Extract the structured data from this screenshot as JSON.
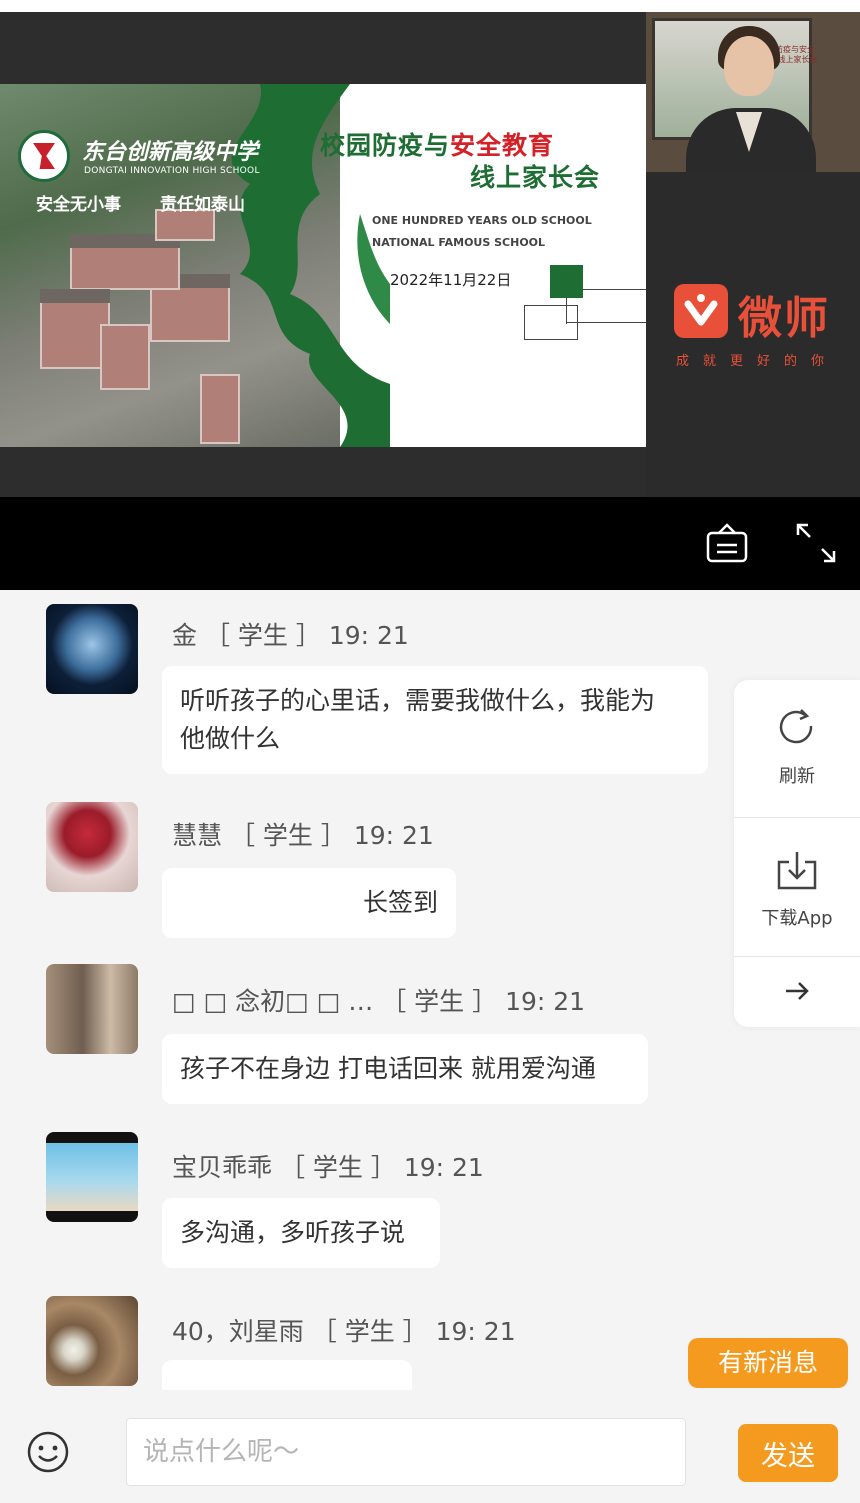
{
  "slide": {
    "school_name": "东台创新高级中学",
    "school_en": "DONGTAI INNOVATION HIGH SCHOOL",
    "slogan_left": "安全无小事",
    "slogan_right": "责任如泰山",
    "title_part1": "校园防疫与",
    "title_part2": "安全教育",
    "title_line2": "线上家长会",
    "en_line1": "ONE HUNDRED YEARS OLD SCHOOL",
    "en_line2": "NATIONAL FAMOUS SCHOOL",
    "date": "2022年11月22日"
  },
  "camera": {
    "screen_text": "校园防疫与安全教育 线上家长会"
  },
  "brand": {
    "name": "微师",
    "slogan": "成就更好的你",
    "color": "#e8503a"
  },
  "controls": {
    "notice_icon": "notice-board-icon",
    "fullscreen_icon": "fullscreen-icon"
  },
  "messages": [
    {
      "name": "金",
      "role": "［ 学生 ］",
      "time": "19: 21",
      "text_line1": "听听孩子的心里话，需要我做什么，我能为",
      "text_line2": "他做什么"
    },
    {
      "name": "慧慧",
      "role": "［ 学生 ］",
      "time": "19: 21",
      "text": "长签到"
    },
    {
      "name": "□ □ 念初□ □ …",
      "role": "［ 学生 ］",
      "time": "19: 21",
      "text": "孩子不在身边 打电话回来 就用爱沟通"
    },
    {
      "name": "宝贝乖乖",
      "role": "［ 学生 ］",
      "time": "19: 21",
      "text": "多沟通，多听孩子说"
    },
    {
      "name": "40，刘星雨",
      "role": "［ 学生 ］",
      "time": "19: 21",
      "text": ""
    }
  ],
  "side_panel": {
    "refresh_label": "刷新",
    "download_label": "下载App"
  },
  "new_message_label": "有新消息",
  "input": {
    "placeholder": "说点什么呢～",
    "value": "",
    "send_label": "发送"
  },
  "colors": {
    "accent": "#f39a1f",
    "slide_green": "#1e6e33",
    "slide_red": "#d42127"
  }
}
